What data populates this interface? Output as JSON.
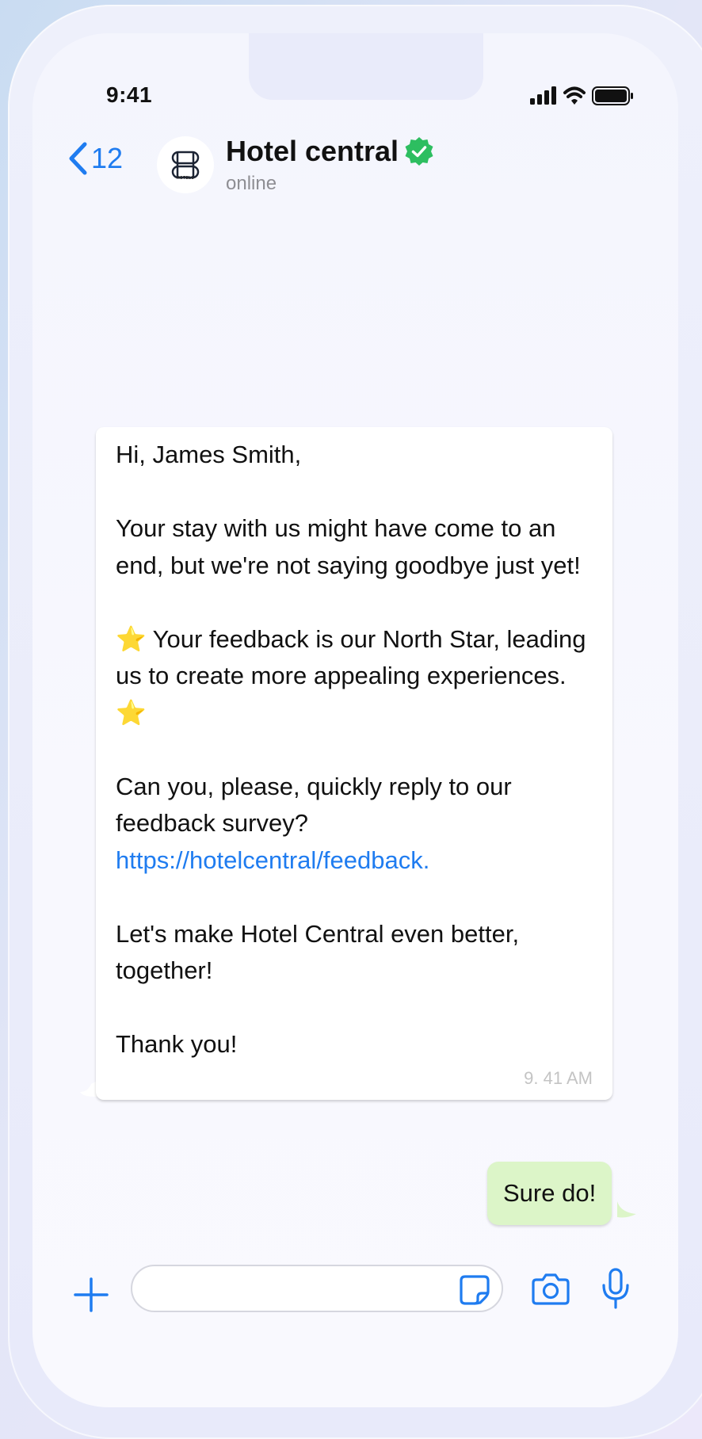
{
  "status_bar": {
    "time": "9:41"
  },
  "header": {
    "back_count": "12",
    "avatar_label": "HOTELS",
    "contact_name": "Hotel central",
    "contact_status": "online",
    "verified_color": "#2dbe60"
  },
  "messages": {
    "incoming": {
      "greeting": "Hi, James Smith,",
      "para1": "Your stay with us might have come to an end, but we're not saying goodbye just yet!",
      "para2_star_left": "⭐",
      "para2_text": " Your feedback is our North Star, leading us to create more appealing experiences. ",
      "para2_star_right": "⭐",
      "para3": "Can you, please, quickly reply to our feedback survey?",
      "link": "https://hotelcentral/feedback.",
      "para4": "Let's make Hotel Central even better, together!",
      "closing": "Thank you!",
      "time": "9. 41 AM"
    },
    "outgoing": {
      "text": "Sure do!"
    }
  },
  "composer": {
    "placeholder": "",
    "value": ""
  },
  "colors": {
    "accent": "#1f7cf0",
    "outgoing_bubble": "#dcf5c8",
    "incoming_bubble": "#ffffff"
  }
}
